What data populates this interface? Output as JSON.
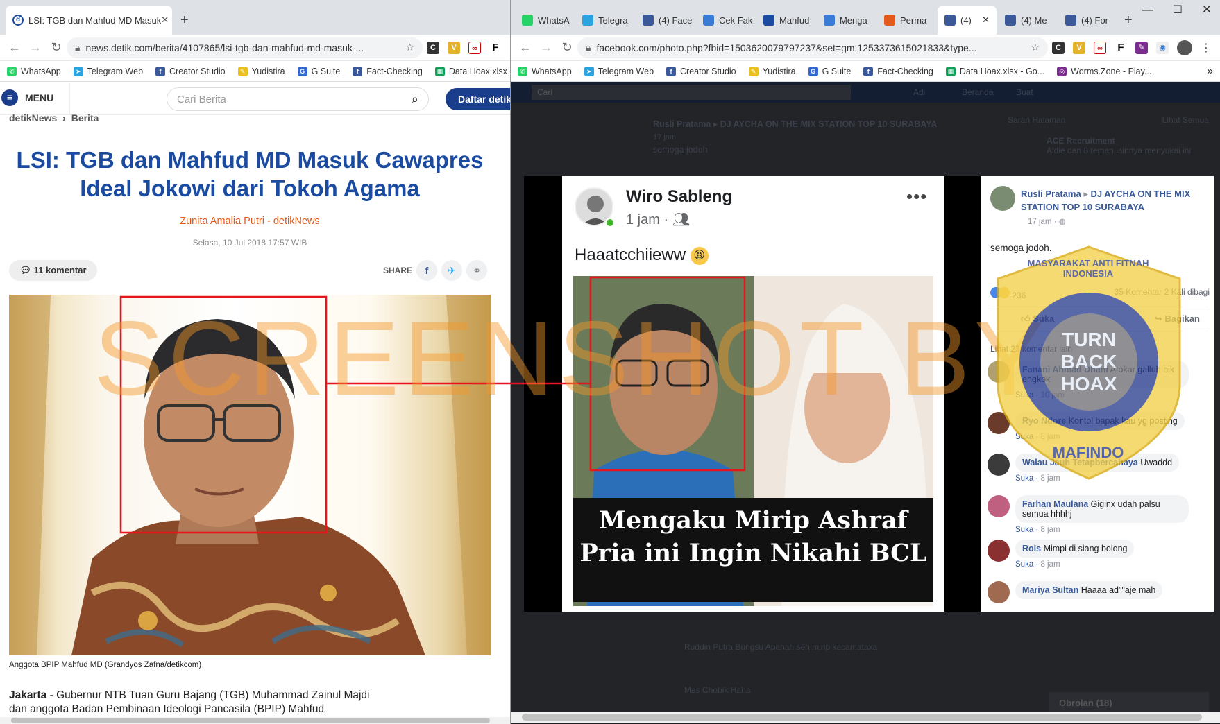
{
  "left_browser": {
    "tab_title": "LSI: TGB dan Mahfud MD Masuk",
    "url": "news.detik.com/berita/4107865/lsi-tgb-dan-mahfud-md-masuk-...",
    "bookmarks": [
      "WhatsApp",
      "Telegram Web",
      "Creator Studio",
      "Yudistira",
      "G Suite",
      "Fact-Checking",
      "Data Hoax.xlsx -"
    ],
    "menu_label": "MENU",
    "search_placeholder": "Cari Berita",
    "register_button": "Daftar detik",
    "breadcrumb": [
      "detikNews",
      "Berita"
    ],
    "article": {
      "title": "LSI: TGB dan Mahfud MD Masuk Cawapres Ideal Jokowi dari Tokoh Agama",
      "author": "Zunita Amalia Putri - detikNews",
      "date": "Selasa, 10 Jul 2018 17:57 WIB",
      "comments": "11 komentar",
      "share_label": "SHARE",
      "photo_caption": "Anggota BPIP Mahfud MD (Grandyos Zafna/detikcom)",
      "body_city": "Jakarta",
      "body_text": " - Gubernur NTB Tuan Guru Bajang (TGB) Muhammad Zainul Majdi dan anggota Badan Pembinaan Ideologi Pancasila (BPIP) Mahfud"
    }
  },
  "right_browser": {
    "tabs": [
      "WhatsA",
      "Telegra",
      "(4) Face",
      "Cek Fak",
      "Mahfud",
      "Menga",
      "Perma",
      "(4)",
      "(4) Me",
      "(4) For"
    ],
    "url": "facebook.com/photo.php?fbid=1503620079797237&set=gm.1253373615021833&type...",
    "bookmarks": [
      "WhatsApp",
      "Telegram Web",
      "Creator Studio",
      "Yudistira",
      "G Suite",
      "Fact-Checking",
      "Data Hoax.xlsx - Go...",
      "Worms.Zone - Play..."
    ],
    "fb_search_placeholder": "Cari",
    "fb_nav": [
      "Adi",
      "Beranda",
      "Buat"
    ],
    "post": {
      "author": "Wiro Sableng",
      "time": "1 jam",
      "text": "Haaatcchiieww",
      "image_caption_1": "Mengaku Mirip Ashraf",
      "image_caption_2": "Pria ini Ingin Nikahi BCL"
    },
    "side_post": {
      "author": "Rusli Pratama",
      "group": "DJ AYCHA ON THE MIX STATION TOP 10 SURABAYA",
      "time": "17 jam",
      "text": "semoga jodoh.",
      "reactions": "236",
      "comments_count": "35 Komentar",
      "shares": "2 Kali dibagi",
      "like": "Suka",
      "share": "Bagikan",
      "more_comments": "Lihat 23 komentar lain"
    },
    "comments": [
      {
        "name": "Fanani Ahmad Dhani",
        "text": "Atokar galluh bik engkok",
        "time": "10 jam"
      },
      {
        "name": "Ryo Ndore",
        "text": "Kontol bapak kau yg posting",
        "time": "8 jam"
      },
      {
        "name": "Walau Jauh Tetapbercahaya",
        "text": "Uwaddd",
        "time": "8 jam"
      },
      {
        "name": "Farhan Maulana",
        "text": "Giginx udah palsu semua hhhhj",
        "time": "8 jam"
      },
      {
        "name": "Rois",
        "text": "Mimpi di siang bolong",
        "time": "8 jam"
      },
      {
        "name": "Mariya Sultan",
        "text": "Haaaa ad\"\"aje mah",
        "time": ""
      }
    ],
    "comment_like": "Suka",
    "bg_header_name": "Rusli Pratama",
    "bg_header_group": "DJ AYCHA ON THE MIX STATION TOP 10 SURABAYA",
    "bg_time": "17 jam",
    "bg_text": "semoga jodoh",
    "bg_suggest_title": "Saran Halaman",
    "bg_suggest_all": "Lihat Semua",
    "bg_suggest_name": "ACE Recruitment",
    "bg_suggest_desc": "Aldie dan 8 teman lainnya menyukai ini",
    "bg_comment1": "Ruddin Putra Bungsu Apanah seh mirip kacamataxa",
    "bg_comment2": "Mas Chobik Haha",
    "bg_chat": "Obrolan (18)"
  },
  "overlay": {
    "watermark": "SCREENSHOT BY",
    "stamp_text": "MASYARAKAT ANTI FITNAH INDONESIA",
    "stamp_center": "TURN BACK HOAX",
    "stamp_bottom": "MAFINDO",
    "highlight_color": "#e8141b"
  }
}
